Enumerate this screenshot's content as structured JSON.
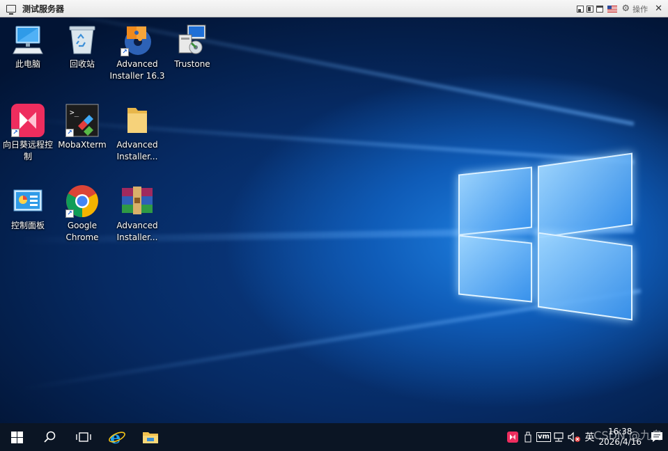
{
  "window": {
    "title": "测试服务器",
    "actions_label": "操作",
    "close_glyph": "✕"
  },
  "desktop": {
    "icons": [
      {
        "label": "此电脑",
        "icon": "computer-icon",
        "shortcut": false
      },
      {
        "label": "回收站",
        "icon": "recycle-bin-icon",
        "shortcut": false
      },
      {
        "label": "Advanced\nInstaller 16.3",
        "icon": "advanced-installer-icon",
        "shortcut": true
      },
      {
        "label": "Trustone",
        "icon": "installer-package-icon",
        "shortcut": false
      },
      {
        "label": "向日葵远程控\n制",
        "icon": "sunlogin-icon",
        "shortcut": true
      },
      {
        "label": "MobaXterm",
        "icon": "mobaxterm-icon",
        "shortcut": true
      },
      {
        "label": "Advanced\nInstaller...",
        "icon": "folder-icon",
        "shortcut": false
      },
      {
        "label": "控制面板",
        "icon": "control-panel-icon",
        "shortcut": false
      },
      {
        "label": "Google\nChrome",
        "icon": "chrome-icon",
        "shortcut": true
      },
      {
        "label": "Advanced\nInstaller...",
        "icon": "winrar-archive-icon",
        "shortcut": false
      }
    ]
  },
  "taskbar": {
    "items": [
      "start-icon",
      "search-icon",
      "task-view-icon",
      "internet-explorer-icon",
      "file-explorer-icon"
    ],
    "tray": {
      "ime": "英",
      "time": "16:38",
      "date": "2026/4/16",
      "vm_label": "vm"
    }
  },
  "watermark": "CSDN @九乌",
  "colors": {
    "taskbar": "#0b1524",
    "desktop_accent": "#1e7fe0",
    "sunlogin": "#ee2d5e"
  }
}
